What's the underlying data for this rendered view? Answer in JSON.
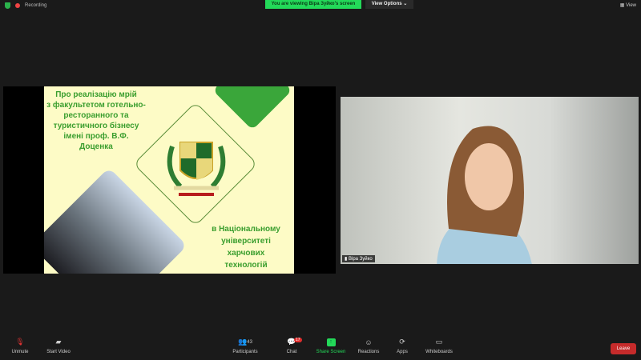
{
  "topbar": {
    "recording_label": "Recording",
    "banner": "You are viewing Віра Зуйко's screen",
    "view_options": "View Options",
    "view_button": "View"
  },
  "slide": {
    "title_lines": [
      "Про реалізацію мрій",
      "з факультетом готельно-",
      "ресторанного та",
      "туристичного бізнесу",
      "імені проф. В.Ф.",
      "Доценка"
    ],
    "bottom_lines": [
      "в Національному",
      "університеті",
      "харчових",
      "технологій"
    ]
  },
  "video": {
    "participant_name": "Віра Зуйко"
  },
  "toolbar": {
    "unmute": "Unmute",
    "start_video": "Start Video",
    "participants": "Participants",
    "participants_count": "43",
    "chat": "Chat",
    "chat_badge": "17",
    "share_screen": "Share Screen",
    "reactions": "Reactions",
    "apps": "Apps",
    "whiteboards": "Whiteboards",
    "leave": "Leave"
  }
}
